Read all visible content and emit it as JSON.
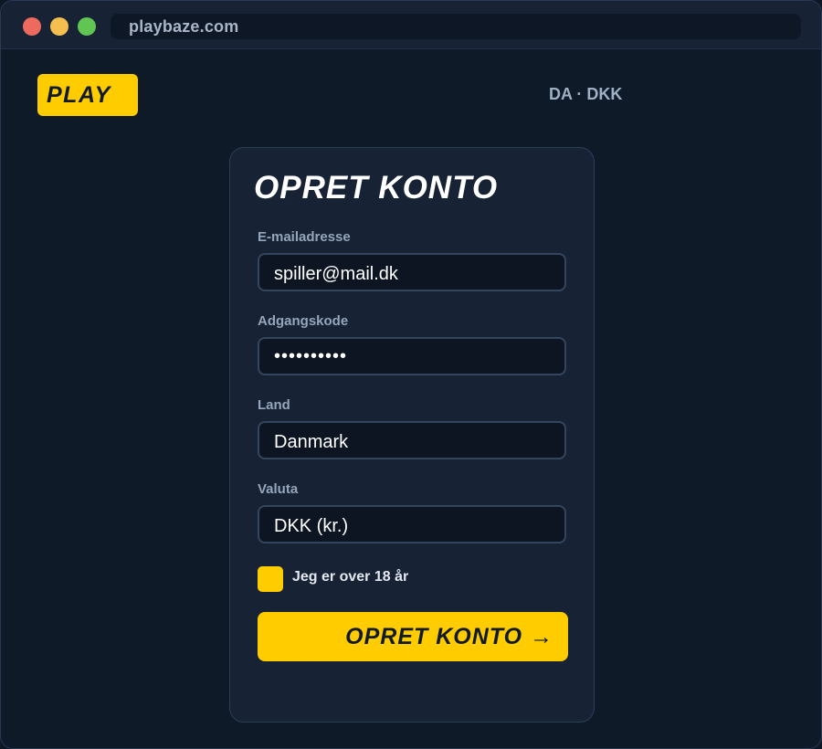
{
  "browser": {
    "url": "playbaze.com",
    "traffic_lights": [
      "close-dot",
      "minimize-dot",
      "maximize-dot"
    ]
  },
  "header": {
    "logo_text": "PLAY",
    "locale": "DA · DKK"
  },
  "form": {
    "title": "OPRET KONTO",
    "email": {
      "label": "E-mailadresse",
      "value": "spiller@mail.dk"
    },
    "password": {
      "label": "Adgangskode",
      "value": "••••••••••"
    },
    "country": {
      "label": "Land",
      "value": "Danmark"
    },
    "currency": {
      "label": "Valuta",
      "value": "DKK (kr.)"
    },
    "age_checkbox": {
      "label": "Jeg er over 18 år",
      "checked": false
    },
    "submit_label": "OPRET KONTO →"
  },
  "colors": {
    "accent": "#ffcc00",
    "background": "#0f1a29",
    "card": "#172335",
    "input": "#0d1522"
  }
}
